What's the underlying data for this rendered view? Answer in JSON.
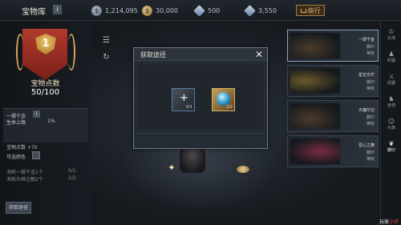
{
  "header": {
    "title": "宝物库",
    "info": "i",
    "currencies": [
      {
        "icon": "silver-coin-icon",
        "value": "1,214,095"
      },
      {
        "icon": "gold-coin-icon",
        "value": "30,000"
      },
      {
        "icon": "diamond-icon",
        "value": "500"
      },
      {
        "icon": "blue-gem-icon",
        "value": "3,550"
      }
    ],
    "shop_label": "商行"
  },
  "left_panel": {
    "rank": "1",
    "points_label": "宝物点数",
    "points_value": "50/100",
    "stat_title": "一掷千金",
    "stat_info": "i",
    "stat_name": "生命上限",
    "stat_value": "1%",
    "treasure_points": "宝物点数  +70",
    "selectable_color": "可选颜色",
    "conditions": [
      {
        "text": "消耗一掷千金1个",
        "value": "0/1"
      },
      {
        "text": "消耗众神之眼2个",
        "value": "2/2"
      }
    ],
    "get_button": "获取途径"
  },
  "modal": {
    "title": "获取途径",
    "close": "✕",
    "sources": [
      {
        "icon": "enhance-item-icon",
        "count": "0/1"
      },
      {
        "icon": "blue-orb-icon",
        "count": "2/2"
      }
    ]
  },
  "treasures": [
    {
      "name": "一掷千金",
      "s1": "脚印",
      "s2": "稀有"
    },
    {
      "name": "星空光芒",
      "s1": "脚印",
      "s2": "稀有"
    },
    {
      "name": "炎魔印记",
      "s1": "脚印",
      "s2": "稀有"
    },
    {
      "name": "爱心之舞",
      "s1": "脚印",
      "s2": "稀有"
    }
  ],
  "right_nav": [
    {
      "label": "头饰",
      "icon": "crown-icon"
    },
    {
      "label": "时装",
      "icon": "costume-icon"
    },
    {
      "label": "武器",
      "icon": "sword-icon"
    },
    {
      "label": "坐骑",
      "icon": "mount-icon"
    },
    {
      "label": "头像",
      "icon": "portrait-icon"
    },
    {
      "label": "脚印",
      "icon": "footprint-icon"
    }
  ],
  "watermark": {
    "prefix": "玩家",
    "highlight": "小环"
  }
}
